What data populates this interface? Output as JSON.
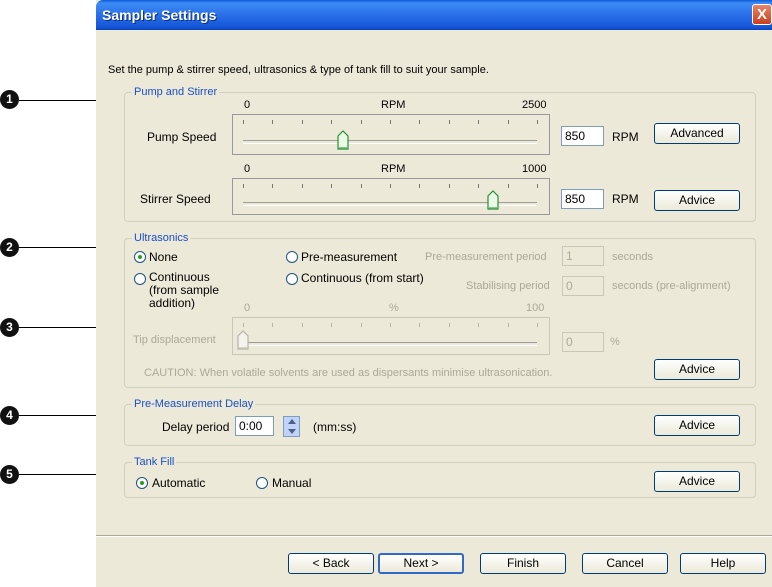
{
  "callouts": [
    "1",
    "2",
    "3",
    "4",
    "5"
  ],
  "window": {
    "title": "Sampler Settings",
    "close_glyph": "X"
  },
  "instruction": "Set the pump & stirrer speed, ultrasonics & type of tank fill to suit your sample.",
  "pump_stirrer": {
    "legend": "Pump and Stirrer",
    "pump": {
      "label": "Pump Speed",
      "min": "0",
      "unit": "RPM",
      "max": "2500",
      "value": "850",
      "value_unit": "RPM",
      "button": "Advanced",
      "level": 0.34
    },
    "stirrer": {
      "label": "Stirrer Speed",
      "min": "0",
      "unit": "RPM",
      "max": "1000",
      "value": "850",
      "value_unit": "RPM",
      "button": "Advice",
      "level": 0.85
    }
  },
  "ultrasonics": {
    "legend": "Ultrasonics",
    "none": "None",
    "continuous": "Continuous (from sample addition)",
    "pre_measurement": "Pre-measurement",
    "continuous_start": "Continuous (from start)",
    "pre_period_label": "Pre-measurement period",
    "pre_period_value": "1",
    "pre_period_unit": "seconds",
    "stab_label": "Stabilising period",
    "stab_value": "0",
    "stab_unit": "seconds (pre-alignment)",
    "tip_min": "0",
    "tip_unit": "%",
    "tip_max": "100",
    "tip_label": "Tip displacement",
    "tip_value": "0",
    "tip_value_unit": "%",
    "tip_level": 0.0,
    "caution": "CAUTION: When volatile solvents are used as dispersants minimise ultrasonication.",
    "button": "Advice"
  },
  "delay": {
    "legend": "Pre-Measurement Delay",
    "label": "Delay period",
    "value": "0:00",
    "unit": "(mm:ss)",
    "button": "Advice"
  },
  "tank_fill": {
    "legend": "Tank Fill",
    "automatic": "Automatic",
    "manual": "Manual",
    "button": "Advice"
  },
  "footer": {
    "back": "< Back",
    "next": "Next >",
    "finish": "Finish",
    "cancel": "Cancel",
    "help": "Help"
  }
}
